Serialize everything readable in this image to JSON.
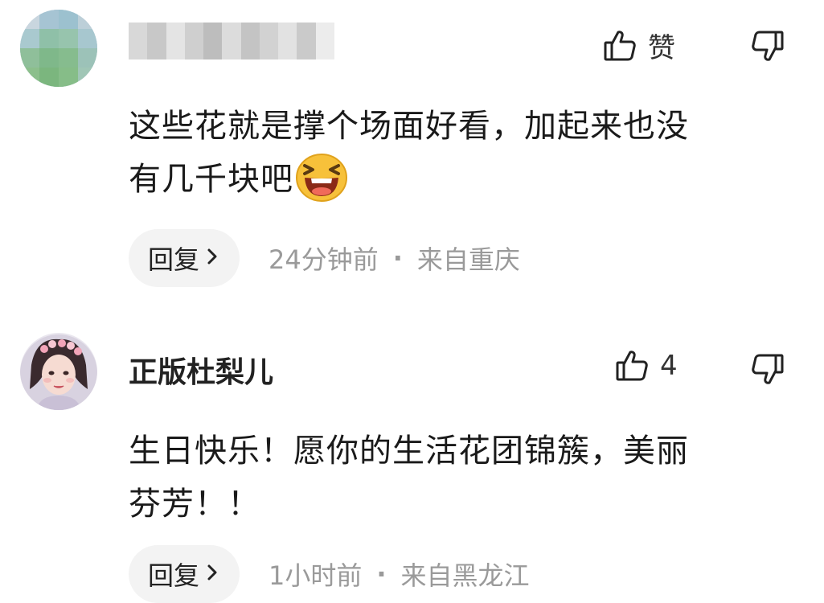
{
  "comments": [
    {
      "username": "",
      "like_label": "赞",
      "body_line1": "这些花就是撑个场面好看，加起来也没",
      "body_line2": "有几千块吧",
      "emoji": "laughing-emoji",
      "reply_label": "回复",
      "time": "24分钟前",
      "separator": "·",
      "location": "来自重庆"
    },
    {
      "username": "正版杜梨儿",
      "like_label": "4",
      "body_line1": "生日快乐！愿你的生活花团锦簇，美丽",
      "body_line2": "芬芳！！",
      "reply_label": "回复",
      "time": "1小时前",
      "separator": "·",
      "location": "来自黑龙江"
    }
  ],
  "icons": {
    "like": "thumbs-up-icon",
    "dislike": "thumbs-down-icon",
    "chevron": "chevron-right-icon"
  },
  "colors": {
    "meta_text": "#9a9a9a",
    "reply_bg": "#f3f3f3",
    "text": "#1a1a1a"
  }
}
